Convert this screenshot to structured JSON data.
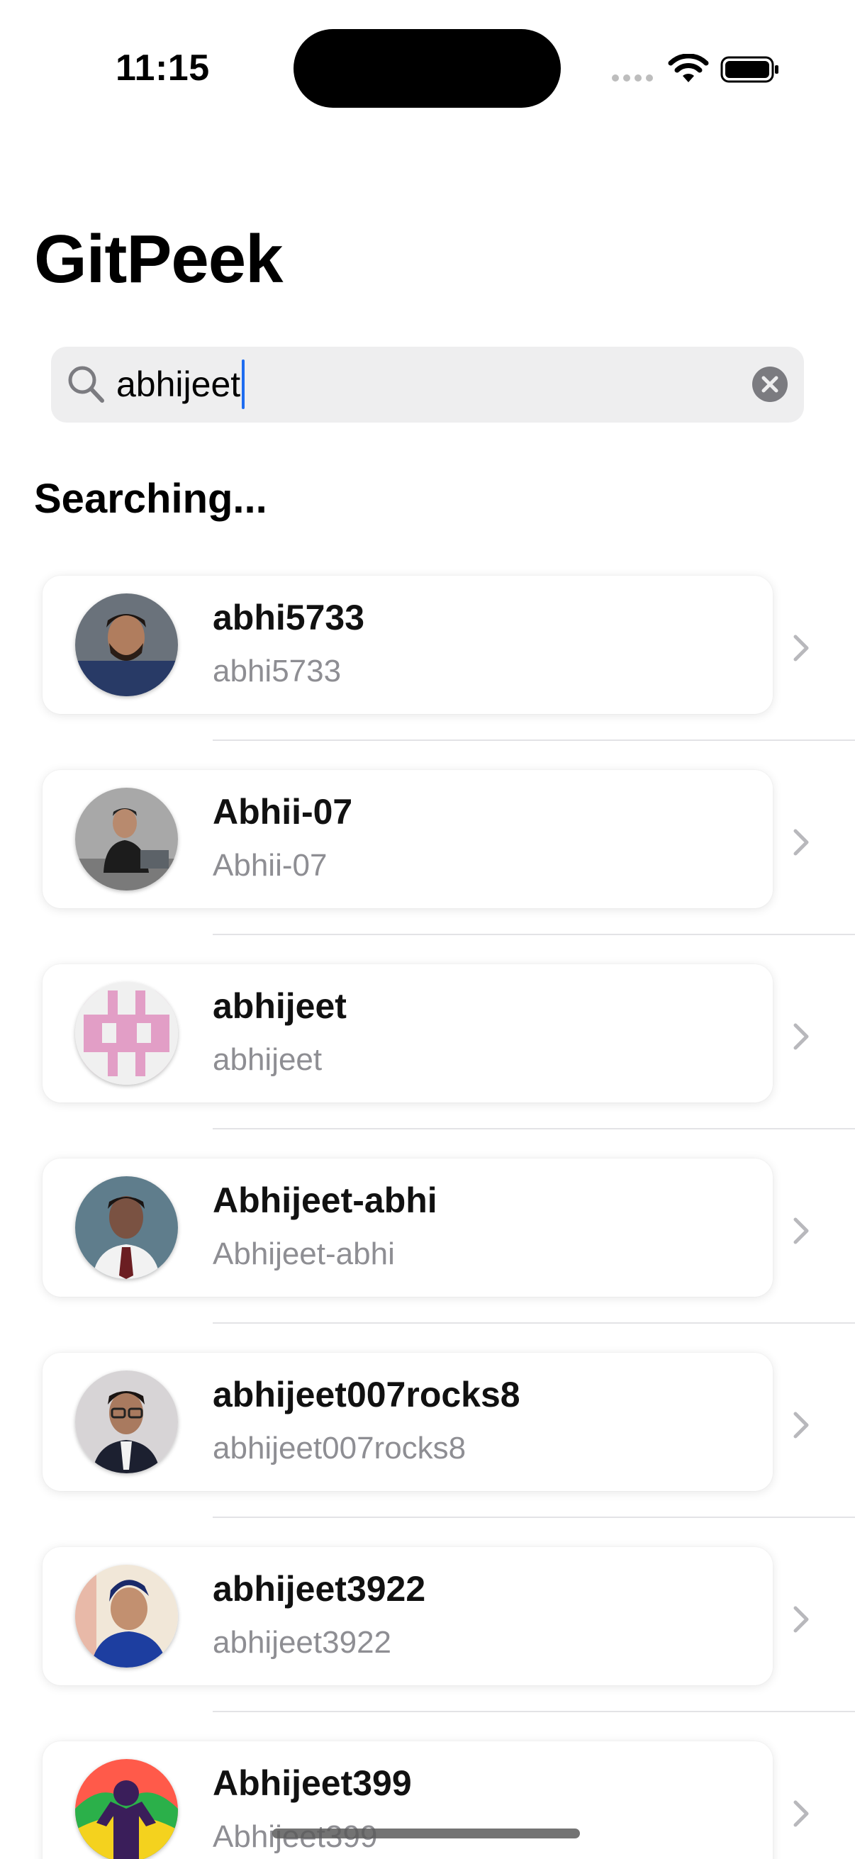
{
  "status_bar": {
    "time": "11:15"
  },
  "app": {
    "title": "GitPeek"
  },
  "search": {
    "value": "abhijeet",
    "placeholder": "Search"
  },
  "status_text": "Searching...",
  "users": [
    {
      "name": "abhi5733",
      "login": "abhi5733",
      "avatar": "photo-man-beard-avatar",
      "bg": "#5a6570"
    },
    {
      "name": "Abhii-07",
      "login": "Abhii-07",
      "avatar": "photo-man-laptop-avatar",
      "bg": "#9a9a9a"
    },
    {
      "name": "abhijeet",
      "login": "abhijeet",
      "avatar": "identicon-avatar",
      "bg": "#f0f0f0",
      "accent": "#e29ec6"
    },
    {
      "name": "Abhijeet-abhi",
      "login": "Abhijeet-abhi",
      "avatar": "photo-man-tie-avatar",
      "bg": "#5f7d8c"
    },
    {
      "name": "abhijeet007rocks8",
      "login": "abhijeet007rocks8",
      "avatar": "photo-man-glasses-avatar",
      "bg": "#d7d4d6"
    },
    {
      "name": "abhijeet3922",
      "login": "abhijeet3922",
      "avatar": "photo-man-blue-avatar",
      "bg": "#f1e7d8"
    },
    {
      "name": "Abhijeet399",
      "login": "Abhijeet399",
      "avatar": "illustration-colorful-avatar",
      "bg": "#ff5a4a"
    }
  ],
  "colors": {
    "accent": "#1e6cf0",
    "secondary_text": "#8e8e93",
    "search_bg": "#eeeeef"
  }
}
